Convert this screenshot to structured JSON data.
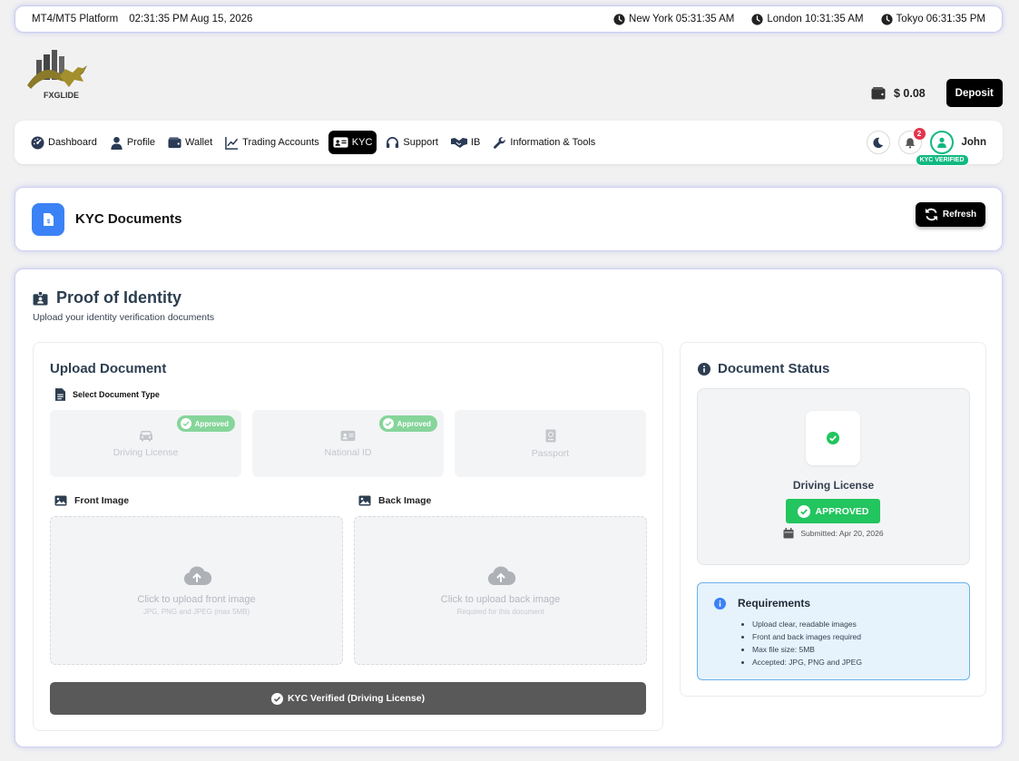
{
  "topbar": {
    "platform": "MT4/MT5 Platform",
    "datetime": "02:31:35 PM Aug 15, 2026",
    "clocks": [
      {
        "label": "New York 05:31:35 AM"
      },
      {
        "label": "London 10:31:35 AM"
      },
      {
        "label": "Tokyo 06:31:35 PM"
      }
    ]
  },
  "logo": {
    "text": "FXGLIDE",
    "icon": "fxglide-logo"
  },
  "wallet": {
    "balance": "$ 0.08",
    "icon": "wallet-icon",
    "deposit_label": "Deposit"
  },
  "nav": {
    "items": [
      {
        "label": "Dashboard",
        "icon": "dashboard-icon"
      },
      {
        "label": "Profile",
        "icon": "user-icon"
      },
      {
        "label": "Wallet",
        "icon": "wallet-icon"
      },
      {
        "label": "Trading Accounts",
        "icon": "chart-line-icon"
      },
      {
        "label": "KYC",
        "icon": "id-card-icon",
        "active": true
      },
      {
        "label": "Support",
        "icon": "headset-icon"
      },
      {
        "label": "IB",
        "icon": "handshake-icon"
      },
      {
        "label": "Information & Tools",
        "icon": "wrench-icon"
      }
    ],
    "notification_count": "2",
    "user_name": "John",
    "kyc_badge": "KYC VERIFIED"
  },
  "header": {
    "title": "KYC Documents",
    "refresh_label": "Refresh"
  },
  "poi": {
    "title": "Proof of Identity",
    "subtitle": "Upload your identity verification documents"
  },
  "upload": {
    "title": "Upload Document",
    "select_label": "Select Document Type",
    "doc_types": [
      {
        "label": "Driving License",
        "approved": "Approved",
        "icon": "car-icon"
      },
      {
        "label": "National ID",
        "approved": "Approved",
        "icon": "id-card-icon"
      },
      {
        "label": "Passport",
        "approved": "",
        "icon": "passport-icon"
      }
    ],
    "front": {
      "label": "Front Image",
      "main": "Click to upload front image",
      "sub": "JPG, PNG and JPEG (max 5MB)"
    },
    "back": {
      "label": "Back Image",
      "main": "Click to upload back image",
      "sub": "Required for this document"
    },
    "verified_label": "KYC Verified (Driving License)"
  },
  "status": {
    "title": "Document Status",
    "doc_name": "Driving License",
    "badge": "APPROVED",
    "submitted": "Submitted: Apr 20, 2026"
  },
  "requirements": {
    "title": "Requirements",
    "items": [
      "Upload clear, readable images",
      "Front and back images required",
      "Max file size: 5MB",
      "Accepted: JPG, PNG and JPEG"
    ]
  },
  "colors": {
    "accent_blue": "#3b82f6",
    "success_green": "#22c55e",
    "kyc_green": "#10b981",
    "approved_pill": "#86d59a",
    "notification_red": "#e3344b"
  }
}
